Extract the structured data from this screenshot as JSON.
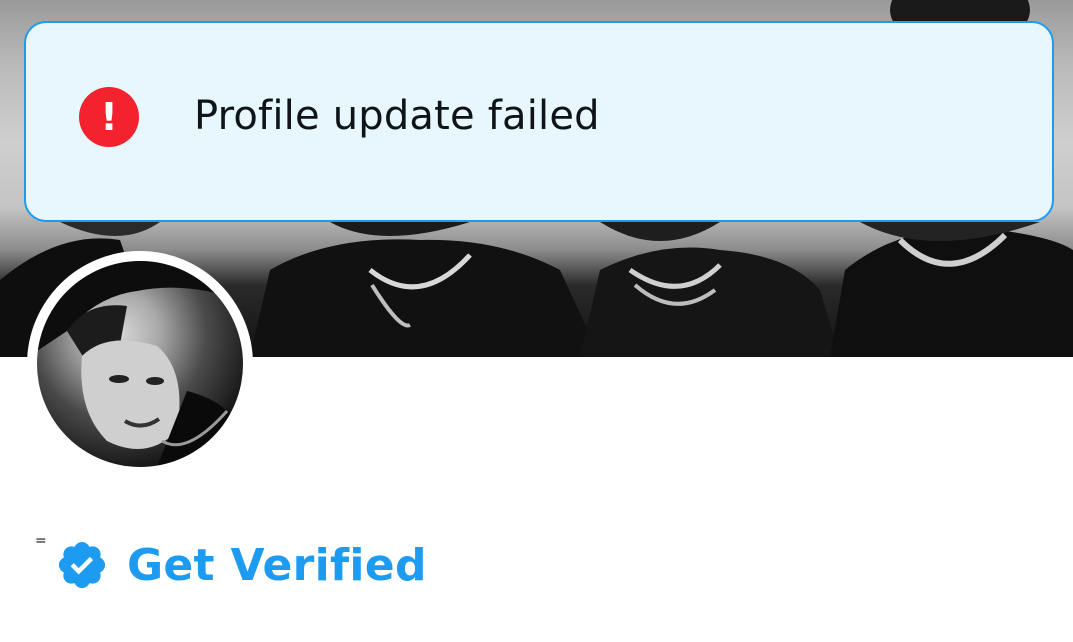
{
  "toast": {
    "message": "Profile update failed",
    "icon": "error-exclamation-icon",
    "colors": {
      "background": "#e8f7fd",
      "border": "#1d9bf0",
      "icon": "#f4212e",
      "text": "#0f1419"
    }
  },
  "banner": {
    "image": "header-photo"
  },
  "profile": {
    "avatar": "profile-avatar-photo",
    "name_marker": "=",
    "verified": {
      "label": "Get Verified",
      "icon": "verified-badge-icon",
      "color": "#1d9bf0"
    }
  }
}
